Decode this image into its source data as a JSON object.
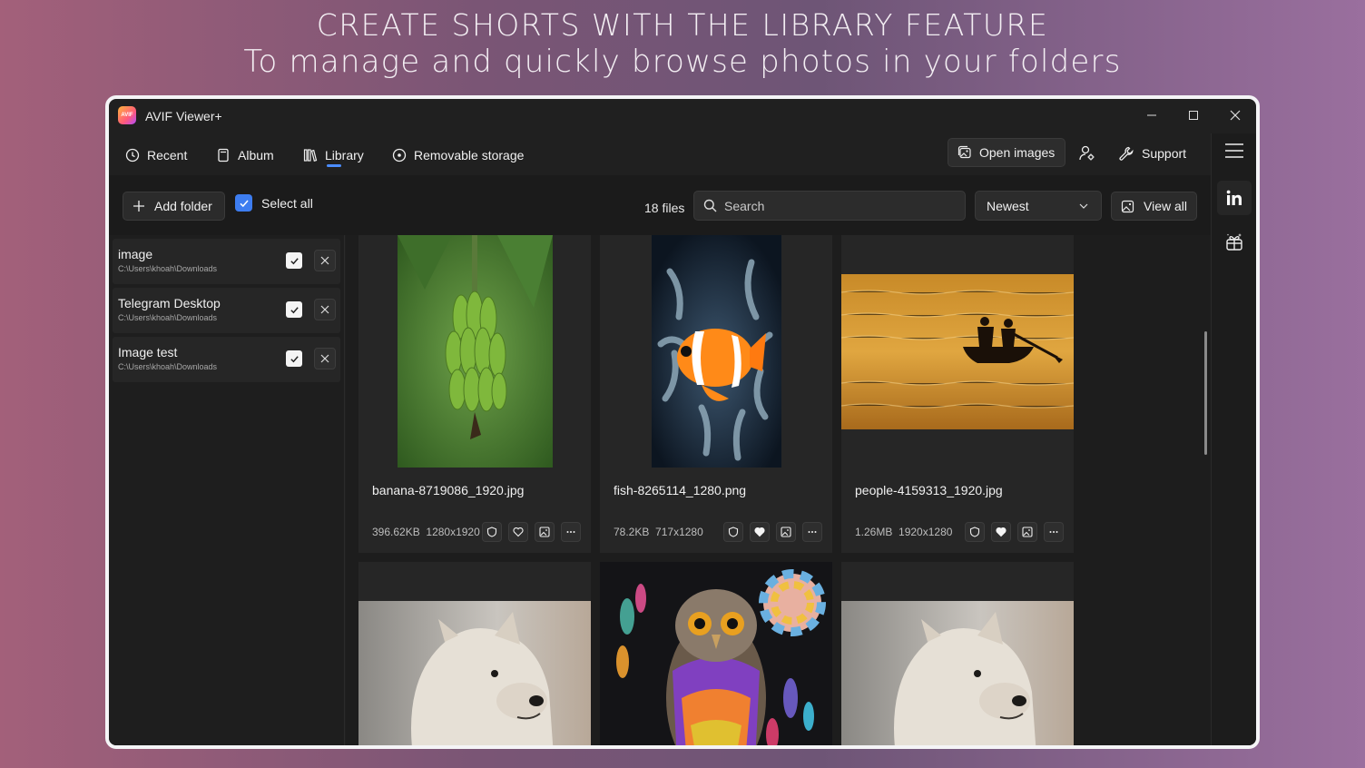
{
  "promo": {
    "line1": "CREATE SHORTS WITH THE LIBRARY FEATURE",
    "line2": "To manage and quickly browse photos in your folders"
  },
  "app": {
    "title": "AVIF Viewer+",
    "logo_text": "AVIF"
  },
  "nav": {
    "recent": "Recent",
    "album": "Album",
    "library": "Library",
    "removable": "Removable storage",
    "open_images": "Open images",
    "support": "Support"
  },
  "toolbar": {
    "add_folder": "Add folder",
    "select_all": "Select all",
    "file_count": "18 files",
    "search_placeholder": "Search",
    "sort_value": "Newest",
    "view_all": "View all"
  },
  "folders": [
    {
      "name": "image",
      "path": "C:\\Users\\khoah\\Downloads",
      "checked": true
    },
    {
      "name": "Telegram Desktop",
      "path": "C:\\Users\\khoah\\Downloads",
      "checked": true
    },
    {
      "name": "Image test",
      "path": "C:\\Users\\khoah\\Downloads",
      "checked": true
    }
  ],
  "cards": [
    {
      "file": "banana-8719086_1920.jpg",
      "size": "396.62KB",
      "dims": "1280x1920",
      "favorite": false
    },
    {
      "file": "fish-8265114_1280.png",
      "size": "78.2KB",
      "dims": "717x1280",
      "favorite": true
    },
    {
      "file": "people-4159313_1920.jpg",
      "size": "1.26MB",
      "dims": "1920x1280",
      "favorite": true
    }
  ],
  "colors": {
    "accent": "#3d7df0",
    "window_bg": "#202020",
    "card_bg": "#262626"
  }
}
